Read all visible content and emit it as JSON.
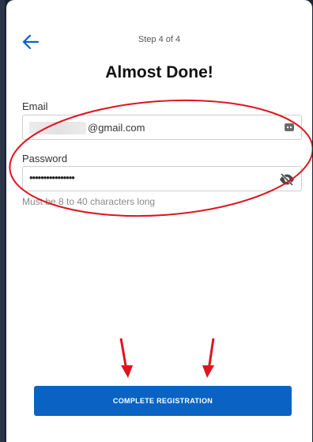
{
  "header": {
    "step": "Step 4 of 4",
    "title": "Almost Done!"
  },
  "form": {
    "email": {
      "label": "Email",
      "value": "@gmail.com"
    },
    "password": {
      "label": "Password",
      "value": "••••••••••••••••",
      "helper": "Must be 8 to 40 characters long"
    }
  },
  "actions": {
    "submit_label": "COMPLETE REGISTRATION"
  },
  "colors": {
    "primary": "#0a63c2",
    "annotation": "#e0141e"
  },
  "icons": {
    "back": "arrow-left-icon",
    "email_trailing": "keyboard-icon",
    "password_toggle": "eye-slash-icon"
  }
}
